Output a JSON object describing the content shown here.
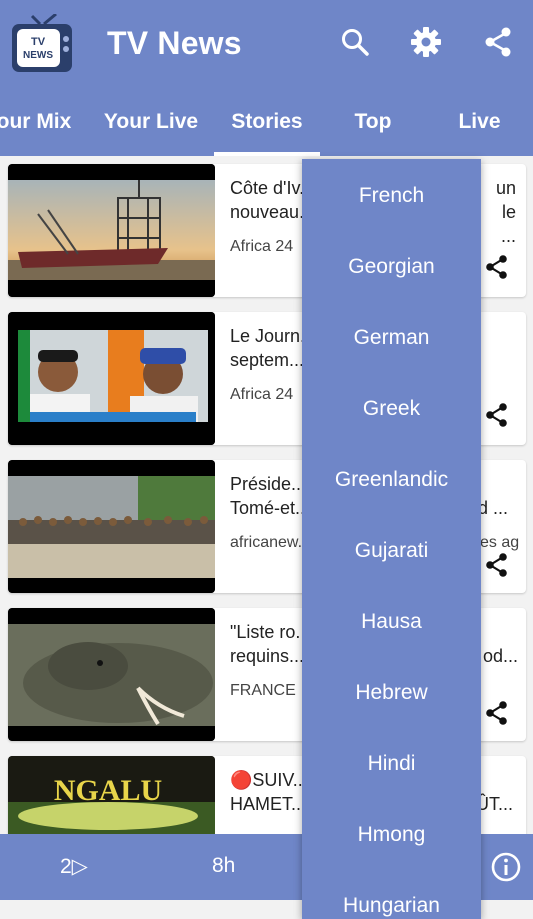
{
  "appbar": {
    "title": "TV News",
    "logo_text_top": "TV",
    "logo_text_bottom": "NEWS",
    "actions": [
      "search-icon",
      "gear-icon",
      "share-icon"
    ]
  },
  "tabs": [
    {
      "label": "our Mix"
    },
    {
      "label": "Your Live"
    },
    {
      "label": "Stories"
    },
    {
      "label": "Top"
    },
    {
      "label": "Live"
    }
  ],
  "active_tab": "Stories",
  "cards": [
    {
      "title": "Côte d'Iv...\nnouveau...",
      "title_right": "un\nle ...",
      "source": "Africa 24",
      "time": ""
    },
    {
      "title": "Le Journ...\nseptem...",
      "title_right": "",
      "source": "Africa 24",
      "time": ""
    },
    {
      "title": "Préside...\nTomé-et...",
      "title_right": "d ...",
      "source": "africanew...",
      "time": "es ag"
    },
    {
      "title": "\"Liste ro...\nrequins...",
      "title_right": "od...",
      "source": "FRANCE",
      "time": ""
    },
    {
      "title": "🔴SUIV...\nHAMET...",
      "title_right": "ÛT...",
      "source": "",
      "time": ""
    }
  ],
  "dropdown": {
    "items": [
      "French",
      "Georgian",
      "German",
      "Greek",
      "Greenlandic",
      "Gujarati",
      "Hausa",
      "Hebrew",
      "Hindi",
      "Hmong",
      "Hungarian"
    ]
  },
  "bottombar": {
    "left": "2▷",
    "middle": "8h"
  },
  "colors": {
    "primary": "#6f86c8",
    "background": "#f2f2f2"
  }
}
